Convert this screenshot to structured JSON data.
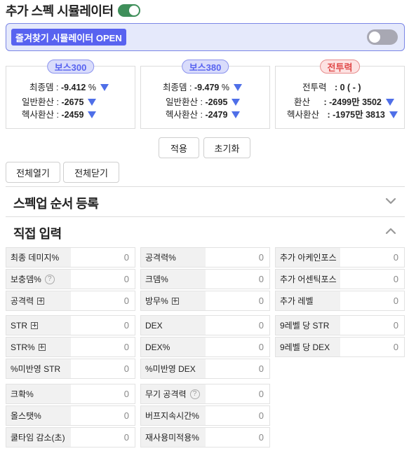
{
  "header": {
    "title": "추가 스펙 시뮬레이터"
  },
  "favorites": {
    "button_label": "즐겨찾기 시뮬레이터 OPEN"
  },
  "cards": {
    "boss300": {
      "badge": "보스300",
      "final_dmg_label": "최종뎀 :",
      "final_dmg_value": "-9.412",
      "final_dmg_unit": "%",
      "general_label": "일반환산 :",
      "general_value": "-2675",
      "hexa_label": "헥사환산 :",
      "hexa_value": "-2459"
    },
    "boss380": {
      "badge": "보스380",
      "final_dmg_label": "최종뎀 :",
      "final_dmg_value": "-9.479",
      "final_dmg_unit": "%",
      "general_label": "일반환산 :",
      "general_value": "-2695",
      "hexa_label": "헥사환산 :",
      "hexa_value": "-2479"
    },
    "combat_power": {
      "badge": "전투력",
      "cp_label": "전투력",
      "cp_value": ": 0 ( - )",
      "conv_label": "환산",
      "conv_value": ": -2499만 3502",
      "hexa_label": "헥사환산",
      "hexa_value": ": -1975만 3813"
    }
  },
  "actions": {
    "apply": "적용",
    "reset": "초기화",
    "expand_all": "전체열기",
    "collapse_all": "전체닫기"
  },
  "sections": {
    "spec_order": "스펙업 순서 등록",
    "direct_input": "직접 입력"
  },
  "fields": {
    "c1": [
      {
        "label": "최종 데미지%",
        "value": "0"
      },
      {
        "label": "보충뎀%",
        "value": "0"
      },
      {
        "label": "공격력",
        "value": "0"
      },
      {
        "label": "STR",
        "value": "0"
      },
      {
        "label": "STR%",
        "value": "0"
      },
      {
        "label": "%미반영 STR",
        "value": "0"
      },
      {
        "label": "크확%",
        "value": "0"
      },
      {
        "label": "올스탯%",
        "value": "0"
      },
      {
        "label": "쿨타임 감소(초)",
        "value": "0"
      }
    ],
    "c2": [
      {
        "label": "공격력%",
        "value": "0"
      },
      {
        "label": "크뎀%",
        "value": "0"
      },
      {
        "label": "방무%",
        "value": "0"
      },
      {
        "label": "DEX",
        "value": "0"
      },
      {
        "label": "DEX%",
        "value": "0"
      },
      {
        "label": "%미반영 DEX",
        "value": "0"
      },
      {
        "label": "무기 공격력",
        "value": "0"
      },
      {
        "label": "버프지속시간%",
        "value": "0"
      },
      {
        "label": "재사용미적용%",
        "value": "0"
      }
    ],
    "c3": [
      {
        "label": "추가 아케인포스",
        "value": "0"
      },
      {
        "label": "추가 어센틱포스",
        "value": "0"
      },
      {
        "label": "추가 레벨",
        "value": "0"
      },
      {
        "label": "9레벨 당 STR",
        "value": "0"
      },
      {
        "label": "9레벨 당 DEX",
        "value": "0"
      }
    ]
  }
}
